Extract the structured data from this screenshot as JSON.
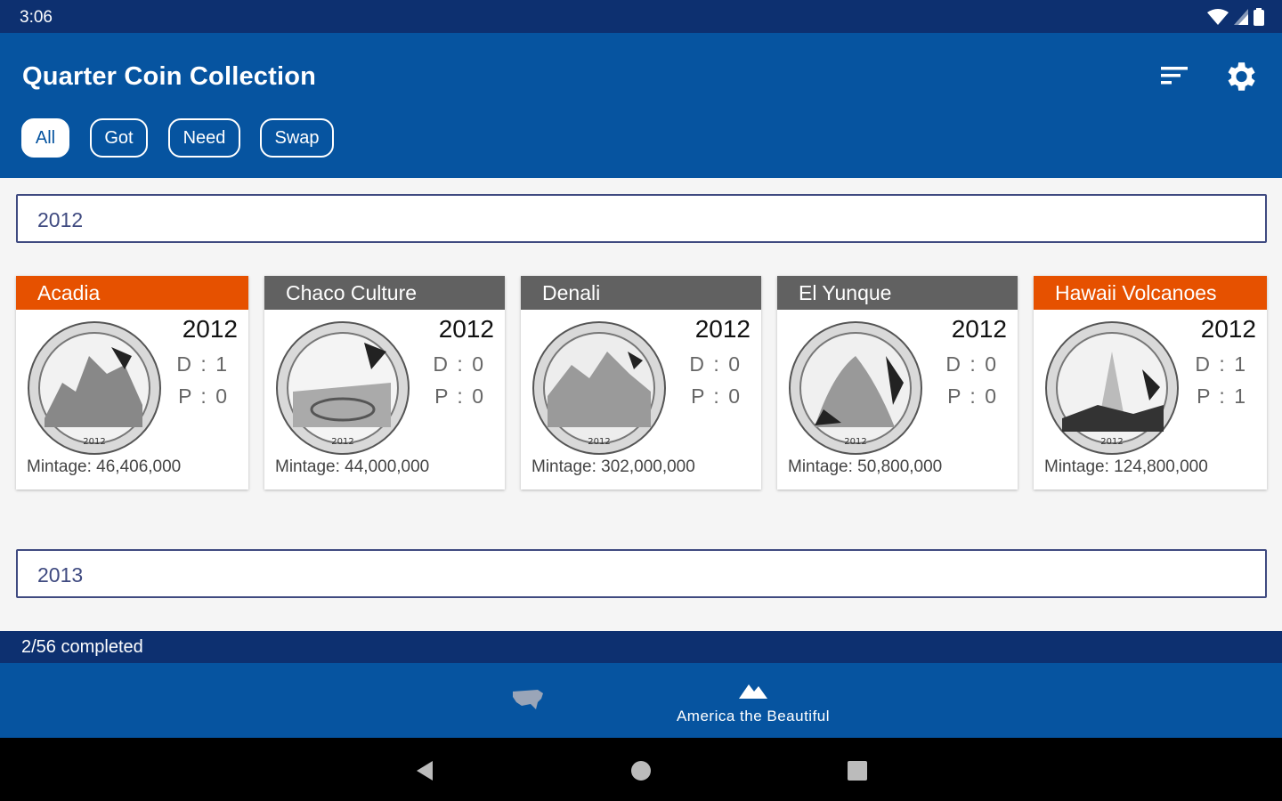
{
  "status_bar": {
    "time": "3:06"
  },
  "app_bar": {
    "title": "Quarter Coin Collection",
    "sort_icon": "sort-icon",
    "settings_icon": "gear-icon"
  },
  "filters": [
    {
      "label": "All",
      "selected": true
    },
    {
      "label": "Got",
      "selected": false
    },
    {
      "label": "Need",
      "selected": false
    },
    {
      "label": "Swap",
      "selected": false
    }
  ],
  "sections": [
    {
      "year": "2012",
      "coins": [
        {
          "name": "Acadia",
          "year": "2012",
          "d": "D : 1",
          "p": "P : 0",
          "mintage": "Mintage: 46,406,000",
          "status": "got"
        },
        {
          "name": "Chaco Culture",
          "year": "2012",
          "d": "D : 0",
          "p": "P : 0",
          "mintage": "Mintage: 44,000,000",
          "status": "need"
        },
        {
          "name": "Denali",
          "year": "2012",
          "d": "D : 0",
          "p": "P : 0",
          "mintage": "Mintage: 302,000,000",
          "status": "need"
        },
        {
          "name": "El Yunque",
          "year": "2012",
          "d": "D : 0",
          "p": "P : 0",
          "mintage": "Mintage: 50,800,000",
          "status": "need"
        },
        {
          "name": "Hawaii Volcanoes",
          "year": "2012",
          "d": "D : 1",
          "p": "P : 1",
          "mintage": "Mintage: 124,800,000",
          "status": "got"
        }
      ]
    },
    {
      "year": "2013",
      "coins": []
    }
  ],
  "progress": {
    "text": "2/56 completed"
  },
  "bottom_nav": [
    {
      "icon": "usa-map-icon",
      "label": ""
    },
    {
      "icon": "mountain-icon",
      "label": "America the Beautiful"
    }
  ],
  "colors": {
    "primary": "#0654a0",
    "dark": "#0d3070",
    "got": "#e65100",
    "need": "#616161"
  }
}
